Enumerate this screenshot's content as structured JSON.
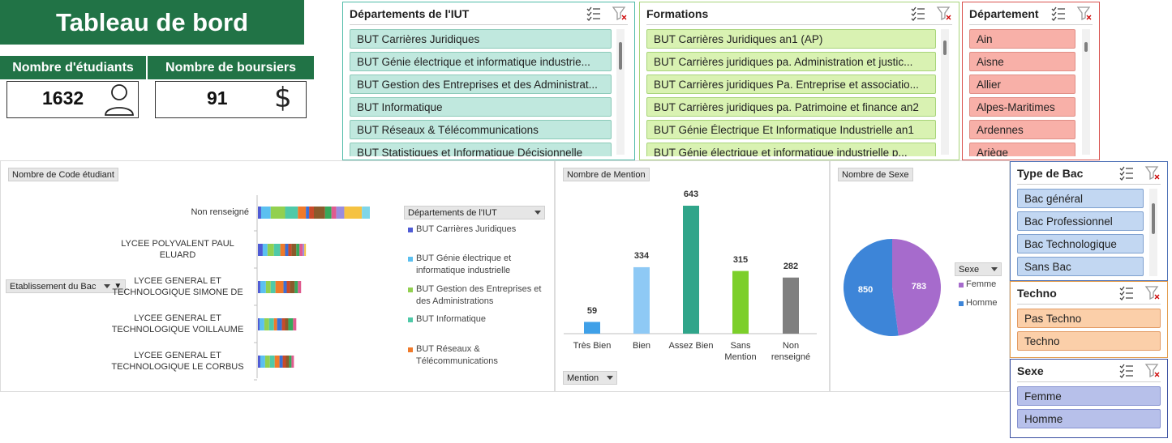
{
  "title": "Tableau de bord",
  "kpis": {
    "students": {
      "label": "Nombre d'étudiants",
      "value": "1632",
      "icon": "person-icon"
    },
    "scholarships": {
      "label": "Nombre de boursiers",
      "value": "91",
      "icon": "dollar-icon"
    }
  },
  "slicers": {
    "departements_iut": {
      "title": "Départements de l'IUT",
      "items": [
        "BUT Carrières Juridiques",
        "BUT Génie électrique et informatique industrie...",
        "BUT Gestion des Entreprises et des Administrat...",
        "BUT Informatique",
        "BUT Réseaux & Télécommunications",
        "BUT Statistiques et Informatique Décisionnelle"
      ]
    },
    "formations": {
      "title": "Formations",
      "items": [
        "BUT Carrières Juridiques an1 (AP)",
        "BUT Carrières juridiques pa. Administration et justic...",
        "BUT Carrières juridiques Pa. Entreprise et associatio...",
        "BUT Carrières juridiques pa. Patrimoine et finance an2",
        "BUT Génie Électrique Et Informatique Industrielle  an1",
        "BUT Génie électrique et informatique industrielle  p..."
      ]
    },
    "departement": {
      "title": "Département",
      "items": [
        "Ain",
        "Aisne",
        "Allier",
        "Alpes-Maritimes",
        "Ardennes",
        "Ariège"
      ]
    },
    "type_bac": {
      "title": "Type de Bac",
      "items": [
        "Bac général",
        "Bac Professionnel",
        "Bac Technologique",
        "Sans Bac"
      ]
    },
    "techno": {
      "title": "Techno",
      "items": [
        "Pas Techno",
        "Techno"
      ]
    },
    "sexe": {
      "title": "Sexe",
      "items": [
        "Femme",
        "Homme"
      ]
    }
  },
  "chart_etab": {
    "value_field": "Nombre de Code étudiant",
    "row_field": "Etablissement du Bac",
    "legend_field": "Départements de l'IUT",
    "categories": [
      "Non renseigné",
      "LYCEE POLYVALENT PAUL ELUARD",
      "LYCEE GENERAL ET TECHNOLOGIQUE SIMONE DE",
      "LYCEE GENERAL ET TECHNOLOGIQUE VOILLAUME",
      "LYCEE GENERAL ET TECHNOLOGIQUE LE CORBUS"
    ],
    "category_lines": [
      [
        "Non renseigné"
      ],
      [
        "LYCEE POLYVALENT PAUL",
        "ELUARD"
      ],
      [
        "LYCEE GENERAL ET",
        "TECHNOLOGIQUE SIMONE DE"
      ],
      [
        "LYCEE GENERAL ET",
        "TECHNOLOGIQUE VOILLAUME"
      ],
      [
        "LYCEE GENERAL ET",
        "TECHNOLOGIQUE LE CORBUS"
      ]
    ],
    "legend": [
      {
        "lines": [
          "BUT Carrières Juridiques"
        ],
        "color": "#4f5bd5"
      },
      {
        "lines": [
          "BUT Génie électrique et",
          "informatique industrielle"
        ],
        "color": "#5bc0f0"
      },
      {
        "lines": [
          "BUT Gestion des Entreprises et",
          "des Administrations"
        ],
        "color": "#92d050"
      },
      {
        "lines": [
          "BUT Informatique"
        ],
        "color": "#4fc9a8"
      },
      {
        "lines": [
          "BUT Réseaux &",
          "Télécommunications"
        ],
        "color": "#f07a2a"
      }
    ],
    "segment_palette": [
      "#4f5bd5",
      "#5bc0f0",
      "#92d050",
      "#4fc9a8",
      "#f07a2a",
      "#3b6fd6",
      "#c94a2a",
      "#8b5a2b",
      "#36a85a",
      "#e05b8f",
      "#9a8cde",
      "#f5c242",
      "#7fd6e8"
    ]
  },
  "chart_data": [
    {
      "type": "bar",
      "title": "Nombre de Code étudiant",
      "orientation": "horizontal",
      "stacked": true,
      "categories": [
        "Non renseigné",
        "LYCEE POLYVALENT PAUL ELUARD",
        "LYCEE GENERAL ET TECHNOLOGIQUE SIMONE DE",
        "LYCEE GENERAL ET TECHNOLOGIQUE VOILLAUME",
        "LYCEE GENERAL ET TECHNOLOGIQUE LE CORBUS"
      ],
      "totals": [
        140,
        60,
        54,
        48,
        45
      ],
      "segments": [
        [
          4,
          12,
          18,
          16,
          10,
          4,
          6,
          14,
          8,
          6,
          10,
          22,
          10
        ],
        [
          6,
          6,
          8,
          8,
          6,
          4,
          4,
          6,
          4,
          4,
          2,
          2
        ],
        [
          3,
          7,
          6,
          6,
          10,
          4,
          4,
          6,
          4,
          4
        ],
        [
          2,
          6,
          6,
          6,
          4,
          6,
          4,
          4,
          6,
          4
        ],
        [
          3,
          6,
          6,
          6,
          6,
          4,
          4,
          4,
          3,
          3
        ]
      ],
      "legend": [
        "BUT Carrières Juridiques",
        "BUT Génie électrique et informatique industrielle",
        "BUT Gestion des Entreprises et des Administrations",
        "BUT Informatique",
        "BUT Réseaux & Télécommunications"
      ],
      "xlabel": "",
      "ylabel": ""
    },
    {
      "type": "bar",
      "title": "Nombre de Mention",
      "categories": [
        "Très Bien",
        "Bien",
        "Assez Bien",
        "Sans Mention",
        "Non renseigné"
      ],
      "category_lines": [
        [
          "Très Bien"
        ],
        [
          "Bien"
        ],
        [
          "Assez Bien"
        ],
        [
          "Sans",
          "Mention"
        ],
        [
          "Non",
          "renseigné"
        ]
      ],
      "values": [
        59,
        334,
        643,
        315,
        282
      ],
      "colors": [
        "#3fa0e8",
        "#8ec9f5",
        "#30a58a",
        "#7ccf2a",
        "#7f7f7f"
      ],
      "ylim": [
        0,
        700
      ],
      "filter_field": "Mention",
      "xlabel": "",
      "ylabel": ""
    },
    {
      "type": "pie",
      "title": "Nombre de Sexe",
      "labels": [
        "Femme",
        "Homme"
      ],
      "values": [
        783,
        850
      ],
      "colors": [
        "#a66bcc",
        "#3d85d8"
      ],
      "legend_field": "Sexe"
    }
  ]
}
